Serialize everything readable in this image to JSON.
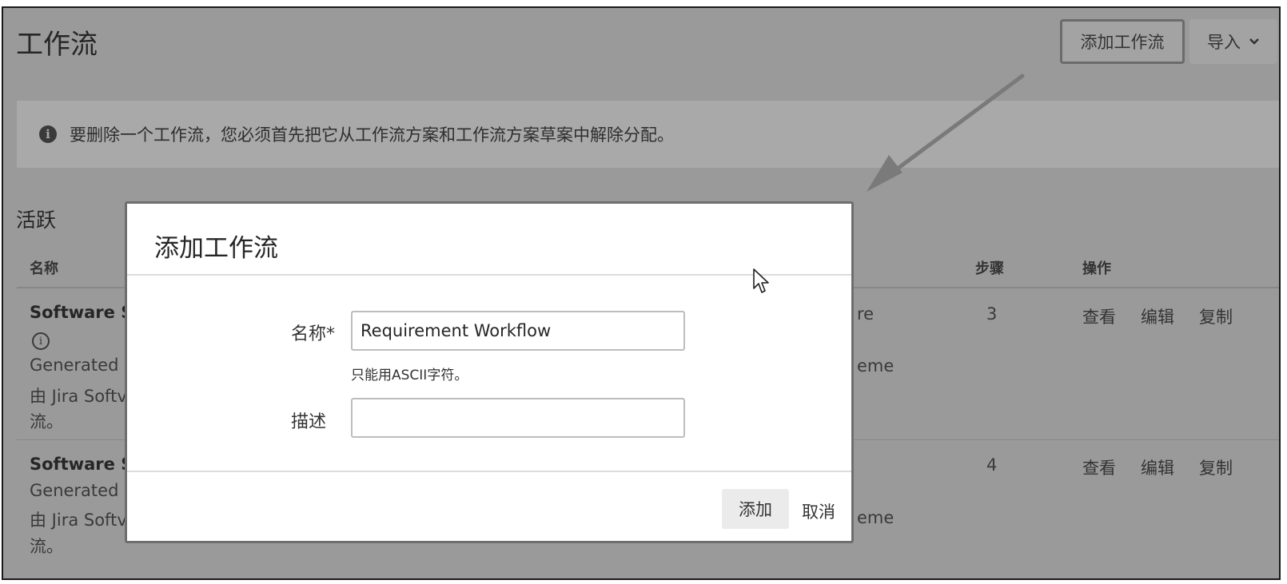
{
  "page": {
    "title": "工作流",
    "add_workflow_button": "添加工作流",
    "import_button": "导入",
    "info_message": "要删除一个工作流，您必须首先把它从工作流方案和工作流方案草案中解除分配。",
    "section_active": "活跃"
  },
  "table": {
    "headers": {
      "name": "名称",
      "steps": "步骤",
      "actions": "操作"
    },
    "rows": [
      {
        "name": "Software S",
        "line1": "Generated l",
        "line2": "由 Jira Softv",
        "line3": "流。",
        "mid1": "re",
        "mid2": "eme",
        "steps": "3",
        "actions": [
          "查看",
          "编辑",
          "复制"
        ]
      },
      {
        "name": "Software S",
        "line1": "Generated l",
        "line2": "由 Jira Softv",
        "line3": "流。",
        "mid2": "eme",
        "steps": "4",
        "actions": [
          "查看",
          "编辑",
          "复制"
        ]
      }
    ]
  },
  "dialog": {
    "title": "添加工作流",
    "name_label": "名称*",
    "name_value": "Requirement Workflow",
    "name_hint": "只能用ASCII字符。",
    "description_label": "描述",
    "description_value": "",
    "add_button": "添加",
    "cancel_button": "取消"
  },
  "colors": {
    "overlay": "#9a9a9a",
    "banner": "#a9a9a9",
    "dialog_bg": "#ffffff",
    "arrow": "#7a7a7a"
  },
  "icons": {
    "info_icon": "info-solid",
    "row_info_icon": "info-outline",
    "import_chevron": "chevron-down",
    "pointer": "mouse-cursor",
    "annotation": "arrow"
  }
}
